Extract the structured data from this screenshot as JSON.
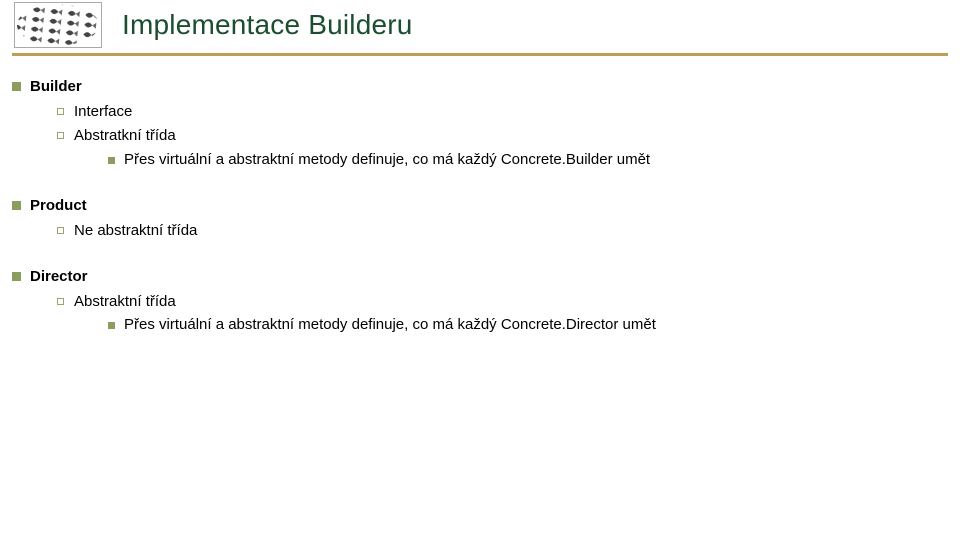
{
  "title": "Implementace Builderu",
  "sections": {
    "builder": {
      "heading": "Builder",
      "item0": "Interface",
      "item1": "Abstratkní třída",
      "item1_sub0": "Přes virtuální a abstraktní metody definuje, co má každý Concrete.Builder umět"
    },
    "product": {
      "heading": "Product",
      "item0": "Ne abstraktní třída"
    },
    "director": {
      "heading": "Director",
      "item0": "Abstraktní třída",
      "item0_sub0": "Přes virtuální a abstraktní metody definuje, co má každý Concrete.Director umět"
    }
  }
}
